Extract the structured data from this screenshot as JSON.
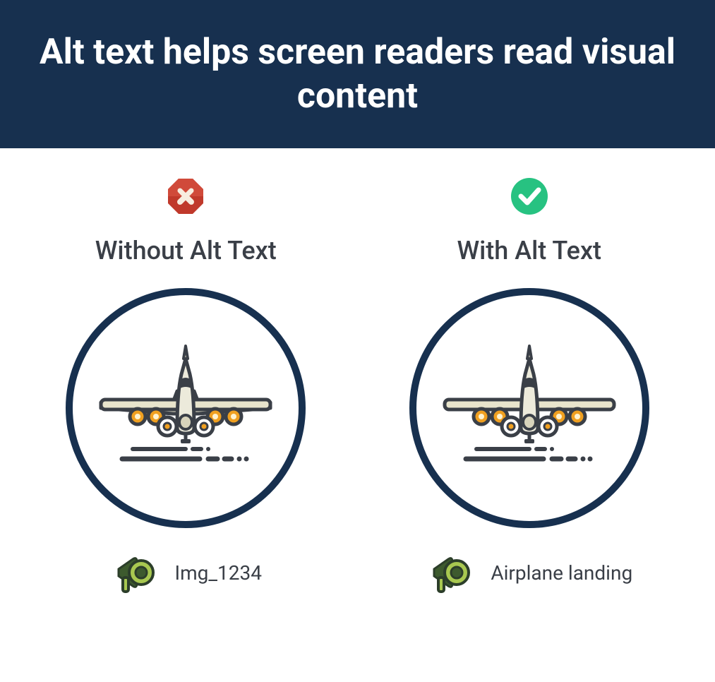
{
  "header": {
    "title": "Alt text helps screen readers read visual content"
  },
  "columns": [
    {
      "badge": "error",
      "heading": "Without Alt Text",
      "caption": "Img_1234"
    },
    {
      "badge": "success",
      "heading": "With Alt Text",
      "caption": "Airplane landing"
    }
  ],
  "colors": {
    "header_bg": "#17304f",
    "text": "#3a3f47",
    "error": "#c0392b",
    "success": "#27c281"
  }
}
